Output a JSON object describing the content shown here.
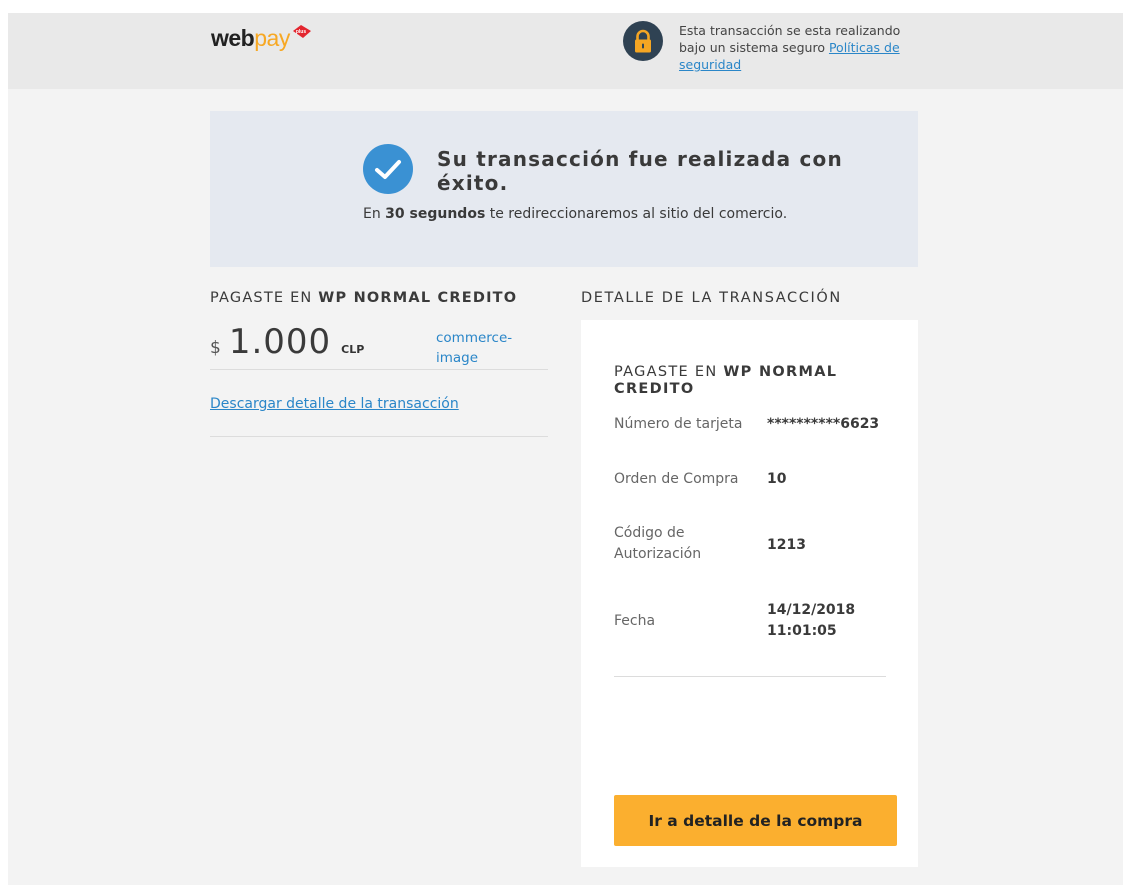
{
  "header": {
    "logo_web": "web",
    "logo_pay": "pay",
    "logo_plus": "plus",
    "secure_text": "Esta transacción se esta realizando bajo un sistema seguro ",
    "secure_link": "Políticas de seguridad",
    "lock_icon": "lock-icon"
  },
  "banner": {
    "check_icon": "check-circle-icon",
    "title": "Su transacción fue realizada con éxito.",
    "msg_prefix": "En ",
    "msg_bold": "30 segundos",
    "msg_suffix": " te redireccionaremos al sitio del comercio."
  },
  "payment": {
    "label_prefix": "PAGASTE EN ",
    "label_merchant": "WP NORMAL CREDITO",
    "currency_symbol": "$",
    "amount": "1.000",
    "currency_code": "CLP",
    "commerce_image": "commerce-image",
    "download_link": "Descargar detalle de la transacción"
  },
  "detail": {
    "section_title": "DETALLE DE LA TRANSACCIÓN",
    "card_title_prefix": "PAGASTE EN ",
    "card_title_merchant": "WP NORMAL CREDITO",
    "rows": [
      {
        "label": "Número de tarjeta",
        "value": "**********6623"
      },
      {
        "label": "Orden de Compra",
        "value": "10"
      },
      {
        "label": "Código de Autorización",
        "value": "1213"
      },
      {
        "label": "Fecha",
        "value": "14/12/2018 11:01:05"
      }
    ],
    "button_label": "Ir a detalle de la compra"
  },
  "colors": {
    "accent_orange": "#fbaf2f",
    "link_blue": "#2a86c8",
    "check_blue": "#3a91d3",
    "banner_bg": "#e5e9f0",
    "lock_dark": "#2f4253"
  }
}
